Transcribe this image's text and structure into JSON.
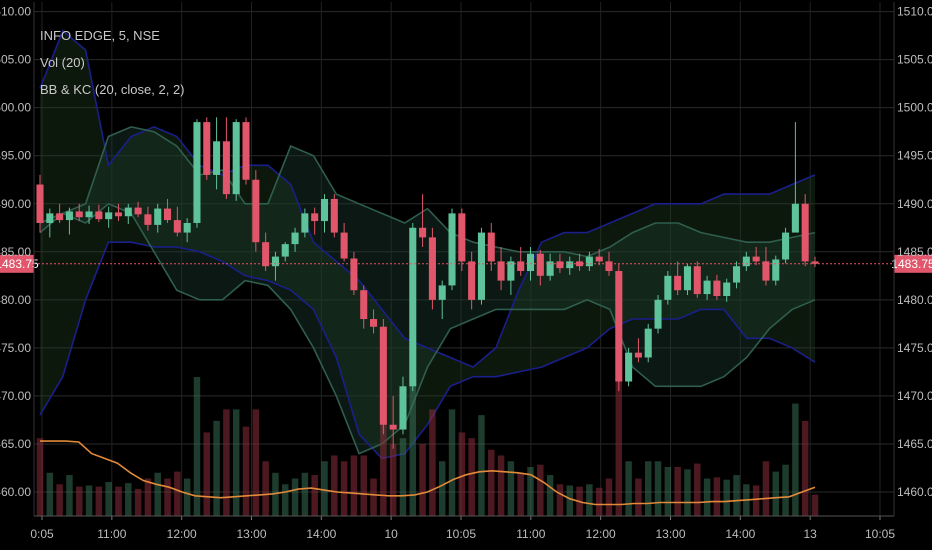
{
  "legend": {
    "symbol": "INFO EDGE, 5, NSE",
    "volume": "Vol (20)",
    "indicator": "BB & KC (20, close, 2, 2)"
  },
  "price_label": "1483.75",
  "chart_data": {
    "type": "candlestick",
    "title": "INFO EDGE, 5, NSE",
    "indicators": [
      "Vol (20)",
      "BB & KC (20, close, 2, 2)"
    ],
    "y_ticks": [
      "1510.00",
      "1505.00",
      "1500.00",
      "1495.00",
      "1490.00",
      "1485.00",
      "1480.00",
      "1475.00",
      "1470.00",
      "1465.00",
      "1460.00"
    ],
    "x_ticks": [
      "0:05",
      "11:00",
      "12:00",
      "13:00",
      "14:00",
      "10",
      "10:05",
      "11:00",
      "12:00",
      "13:00",
      "14:00",
      "13",
      "10:05"
    ],
    "ylim": [
      1457.5,
      1511
    ],
    "current_price": 1483.75,
    "grid": true,
    "colors": {
      "up": "#5ec29a",
      "down": "#e2566b",
      "bb": "#1a1f8a",
      "kc": "#2f5e4e",
      "vol_ma": "#e08a3a",
      "price_line": "#e2566b"
    },
    "candles": [
      [
        1492.0,
        1493.0,
        1487.0,
        1488.0
      ],
      [
        1488.0,
        1489.5,
        1486.5,
        1489.0
      ],
      [
        1489.0,
        1490.0,
        1488.0,
        1488.3
      ],
      [
        1488.3,
        1489.6,
        1486.8,
        1489.2
      ],
      [
        1489.2,
        1490.0,
        1488.2,
        1488.6
      ],
      [
        1488.6,
        1489.8,
        1487.9,
        1489.2
      ],
      [
        1489.2,
        1489.9,
        1488.1,
        1488.4
      ],
      [
        1488.4,
        1489.7,
        1487.5,
        1489.1
      ],
      [
        1489.1,
        1490.0,
        1488.2,
        1488.7
      ],
      [
        1488.7,
        1490.0,
        1487.9,
        1489.6
      ],
      [
        1489.6,
        1490.2,
        1488.6,
        1488.9
      ],
      [
        1488.9,
        1489.7,
        1487.2,
        1487.8
      ],
      [
        1487.8,
        1490.0,
        1487.0,
        1489.5
      ],
      [
        1489.5,
        1490.5,
        1488.0,
        1488.3
      ],
      [
        1488.3,
        1489.7,
        1486.6,
        1487.0
      ],
      [
        1487.0,
        1488.5,
        1486.0,
        1488.0
      ],
      [
        1488.0,
        1498.8,
        1487.5,
        1498.5
      ],
      [
        1498.5,
        1499.0,
        1492.5,
        1493.0
      ],
      [
        1493.0,
        1499.0,
        1491.5,
        1496.5
      ],
      [
        1496.5,
        1499.0,
        1490.5,
        1491.0
      ],
      [
        1491.0,
        1498.8,
        1490.3,
        1498.5
      ],
      [
        1498.5,
        1499.0,
        1492.0,
        1492.5
      ],
      [
        1492.5,
        1493.5,
        1485.0,
        1486.0
      ],
      [
        1486.0,
        1487.0,
        1483.0,
        1483.5
      ],
      [
        1483.5,
        1485.0,
        1482.0,
        1484.5
      ],
      [
        1484.5,
        1486.0,
        1484.0,
        1485.8
      ],
      [
        1485.8,
        1487.5,
        1485.0,
        1487.0
      ],
      [
        1487.0,
        1489.5,
        1486.5,
        1489.0
      ],
      [
        1489.0,
        1489.6,
        1486.8,
        1488.2
      ],
      [
        1488.2,
        1491.0,
        1487.0,
        1490.5
      ],
      [
        1490.5,
        1491.0,
        1486.5,
        1487.0
      ],
      [
        1487.0,
        1488.0,
        1484.0,
        1484.3
      ],
      [
        1484.3,
        1485.0,
        1480.5,
        1481.0
      ],
      [
        1481.0,
        1481.5,
        1477.0,
        1478.0
      ],
      [
        1478.0,
        1479.0,
        1476.5,
        1477.2
      ],
      [
        1477.2,
        1478.0,
        1466.0,
        1467.0
      ],
      [
        1467.0,
        1470.0,
        1464.5,
        1466.5
      ],
      [
        1466.5,
        1472.0,
        1466.0,
        1471.0
      ],
      [
        1471.0,
        1488.0,
        1470.5,
        1487.5
      ],
      [
        1487.5,
        1491.0,
        1485.5,
        1486.5
      ],
      [
        1486.5,
        1487.5,
        1479.0,
        1480.0
      ],
      [
        1480.0,
        1482.0,
        1478.0,
        1481.5
      ],
      [
        1481.5,
        1489.5,
        1481.0,
        1489.0
      ],
      [
        1489.0,
        1489.5,
        1483.0,
        1484.0
      ],
      [
        1484.0,
        1485.0,
        1479.0,
        1480.0
      ],
      [
        1480.0,
        1487.5,
        1479.5,
        1487.0
      ],
      [
        1487.0,
        1488.0,
        1483.0,
        1484.0
      ],
      [
        1484.0,
        1485.5,
        1481.0,
        1482.0
      ],
      [
        1482.0,
        1484.5,
        1480.5,
        1484.0
      ],
      [
        1484.0,
        1485.5,
        1482.5,
        1483.0
      ],
      [
        1483.0,
        1485.5,
        1482.0,
        1484.8
      ],
      [
        1484.8,
        1485.2,
        1481.5,
        1482.5
      ],
      [
        1482.5,
        1484.8,
        1482.0,
        1484.0
      ],
      [
        1484.0,
        1484.8,
        1482.8,
        1483.3
      ],
      [
        1483.3,
        1484.5,
        1482.6,
        1484.0
      ],
      [
        1484.0,
        1484.8,
        1483.0,
        1483.5
      ],
      [
        1483.5,
        1485.0,
        1483.0,
        1484.5
      ],
      [
        1484.5,
        1485.3,
        1483.6,
        1484.0
      ],
      [
        1484.0,
        1485.0,
        1482.5,
        1483.0
      ],
      [
        1483.0,
        1483.8,
        1470.5,
        1471.5
      ],
      [
        1471.5,
        1475.0,
        1471.0,
        1474.5
      ],
      [
        1474.5,
        1476.0,
        1473.5,
        1474.0
      ],
      [
        1474.0,
        1477.5,
        1473.5,
        1477.0
      ],
      [
        1477.0,
        1480.5,
        1476.5,
        1480.0
      ],
      [
        1480.0,
        1483.0,
        1479.5,
        1482.5
      ],
      [
        1482.5,
        1484.0,
        1480.5,
        1481.0
      ],
      [
        1481.0,
        1483.8,
        1480.5,
        1483.5
      ],
      [
        1483.5,
        1484.0,
        1480.2,
        1480.6
      ],
      [
        1480.6,
        1482.5,
        1480.0,
        1482.0
      ],
      [
        1482.0,
        1482.6,
        1480.0,
        1480.4
      ],
      [
        1480.4,
        1482.2,
        1479.8,
        1481.8
      ],
      [
        1481.8,
        1484.0,
        1481.2,
        1483.5
      ],
      [
        1483.5,
        1485.0,
        1483.0,
        1484.5
      ],
      [
        1484.5,
        1485.5,
        1483.6,
        1484.0
      ],
      [
        1484.0,
        1485.5,
        1481.5,
        1482.0
      ],
      [
        1482.0,
        1484.6,
        1481.5,
        1484.2
      ],
      [
        1484.2,
        1487.5,
        1483.8,
        1487.0
      ],
      [
        1487.0,
        1498.5,
        1489.5,
        1490.0
      ],
      [
        1490.0,
        1491.0,
        1483.5,
        1484.0
      ],
      [
        1484.0,
        1484.5,
        1483.4,
        1483.75
      ]
    ],
    "volume_ma": [
      1465.3,
      1465.3,
      1465.3,
      1465.2,
      1464.0,
      1463.5,
      1463.0,
      1462.0,
      1461.2,
      1460.8,
      1460.5,
      1460.0,
      1459.6,
      1459.5,
      1459.4,
      1459.5,
      1459.6,
      1459.7,
      1459.8,
      1460.0,
      1460.3,
      1460.4,
      1460.2,
      1460.0,
      1459.9,
      1459.8,
      1459.7,
      1459.6,
      1459.6,
      1459.7,
      1460.0,
      1460.6,
      1461.3,
      1461.8,
      1462.1,
      1462.2,
      1462.1,
      1462.0,
      1461.8,
      1461.0,
      1460.0,
      1459.3,
      1458.9,
      1458.7,
      1458.7,
      1458.7,
      1458.8,
      1458.8,
      1458.9,
      1458.9,
      1458.9,
      1458.9,
      1459.0,
      1459.0,
      1459.1,
      1459.2,
      1459.3,
      1459.4,
      1459.5,
      1460.0,
      1460.5
    ],
    "bb_upper": [
      1502.0,
      1508.0,
      1506.0,
      1494.0,
      1497.0,
      1498.0,
      1497.0,
      1494.0,
      1493.0,
      1494.0,
      1494.0,
      1492.0,
      1486.0,
      1484.0,
      1482.0,
      1479.0,
      1476.0,
      1475.0,
      1474.0,
      1473.0,
      1475.0,
      1481.0,
      1486.0,
      1487.0,
      1487.0,
      1488.0,
      1489.0,
      1490.0,
      1490.0,
      1490.0,
      1491.0,
      1491.0,
      1491.0,
      1492.0,
      1493.0
    ],
    "bb_lower": [
      1468.0,
      1472.0,
      1480.0,
      1486.0,
      1486.0,
      1485.5,
      1485.5,
      1485.0,
      1484.0,
      1482.5,
      1482.0,
      1481.0,
      1479.0,
      1474.0,
      1466.0,
      1463.5,
      1464.0,
      1467.0,
      1471.0,
      1472.0,
      1472.0,
      1472.5,
      1473.0,
      1474.0,
      1475.0,
      1477.0,
      1478.0,
      1478.0,
      1478.0,
      1479.0,
      1479.0,
      1476.0,
      1476.0,
      1475.0,
      1473.5
    ],
    "kc_upper": [
      1488.0,
      1489.0,
      1490.0,
      1497.0,
      1498.0,
      1497.5,
      1496.0,
      1493.0,
      1493.5,
      1490.0,
      1490.0,
      1496.0,
      1495.0,
      1491.0,
      1490.0,
      1489.0,
      1488.0,
      1489.5,
      1487.0,
      1486.0,
      1485.5,
      1485.0,
      1485.0,
      1485.0,
      1484.5,
      1485.5,
      1487.0,
      1488.0,
      1488.0,
      1487.0,
      1486.5,
      1486.0,
      1486.0,
      1486.5,
      1487.0
    ],
    "kc_lower": [
      1487.0,
      1489.0,
      1488.0,
      1490.0,
      1489.0,
      1485.0,
      1481.0,
      1480.0,
      1480.0,
      1482.0,
      1481.5,
      1479.0,
      1475.0,
      1470.0,
      1464.0,
      1465.0,
      1467.0,
      1473.0,
      1477.0,
      1478.0,
      1479.0,
      1479.0,
      1479.0,
      1479.0,
      1480.0,
      1479.0,
      1473.0,
      1471.0,
      1471.0,
      1471.0,
      1472.0,
      1474.0,
      1477.0,
      1479.0,
      1480.0
    ]
  }
}
